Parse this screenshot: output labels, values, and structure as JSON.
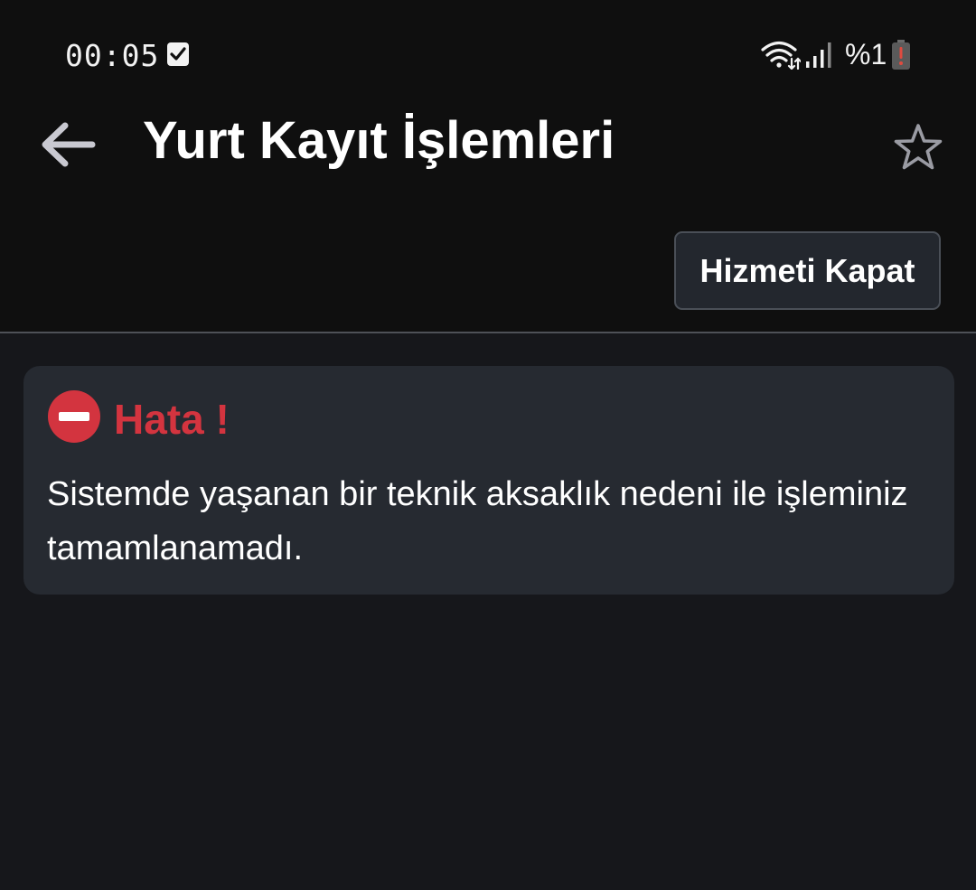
{
  "status_bar": {
    "time": "00:05",
    "battery_text": "%1",
    "icons": [
      "checkbox-notification-icon",
      "wifi-icon",
      "signal-icon",
      "battery-low-icon"
    ]
  },
  "app_bar": {
    "title": "Yurt Kayıt İşlemleri",
    "back_icon": "arrow-left-icon",
    "favorite_icon": "star-outline-icon"
  },
  "actions": {
    "close_service_label": "Hizmeti Kapat"
  },
  "error": {
    "icon": "no-entry-icon",
    "title": "Hata !",
    "message": "Sistemde yaşanan bir teknik aksaklık nedeni ile işleminiz tamamlanamadı."
  },
  "colors": {
    "background": "#16171b",
    "header_background": "#0f0f0f",
    "card_background": "#262a31",
    "error_red": "#d3343f",
    "button_background": "#23272e",
    "button_border": "#4a4f57"
  }
}
